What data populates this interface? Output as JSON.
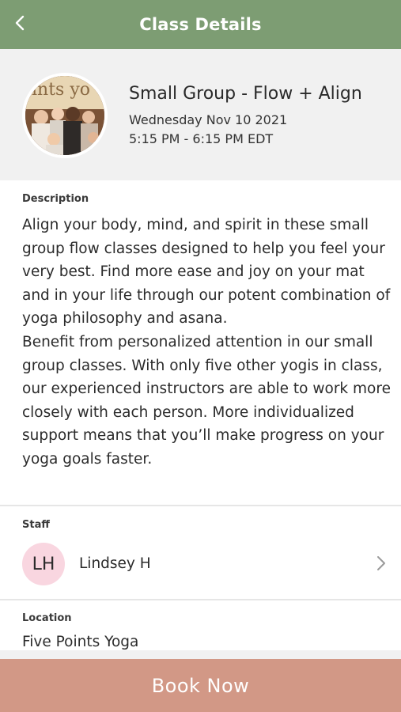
{
  "header": {
    "title": "Class Details",
    "back_icon": "chevron-left-icon",
    "background": "#7d9d73"
  },
  "class": {
    "name": "Small Group - Flow + Align",
    "date": "Wednesday Nov 10 2021",
    "time": "5:15 PM - 6:15 PM EDT",
    "image_logo_text": "ints yo"
  },
  "description": {
    "label": "Description",
    "text": "Align your body, mind, and spirit in these small group flow classes designed to help you feel your very best. Find more ease and joy on your mat and in your life through our potent combination of yoga philosophy and asana.\nBenefit from personalized attention in our small group classes. With only five other yogis in class, our experienced instructors are able to work more closely with each person. More individualized support means that you’ll make progress on your yoga goals faster."
  },
  "staff": {
    "label": "Staff",
    "initials": "LH",
    "name": "Lindsey H",
    "avatar_color": "#f9d6e0",
    "chevron_icon": "chevron-right-icon"
  },
  "location": {
    "label": "Location",
    "name": "Five Points Yoga"
  },
  "book_button": {
    "label": "Book Now",
    "color": "#d29886"
  }
}
